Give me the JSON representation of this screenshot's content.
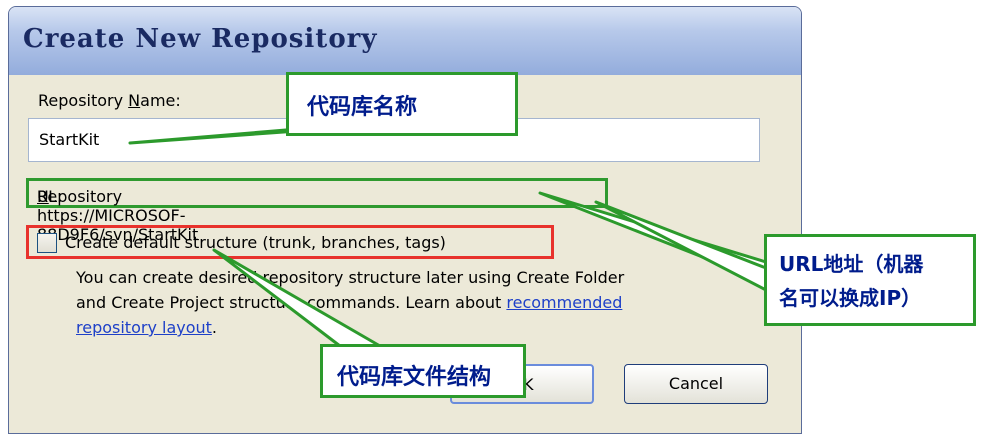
{
  "dialog": {
    "title": "Create New Repository",
    "name_label_pre": "Repository ",
    "name_label_u": "N",
    "name_label_post": "ame:",
    "name_value": "StartKit",
    "url_label_pre": "Repository ",
    "url_label_u": "U",
    "url_label_post": "RL: https://MICROSOF-88D9F6/svn/StartKit",
    "checkbox_label": "Create default structure (trunk, branches, tags)",
    "help_line1": "You can create desired repository structure later using Create Folder",
    "help_line2": "and Create Project structure commands. Learn about ",
    "help_link1": "recommended",
    "help_link2": "repository layout",
    "help_tail": ".",
    "ok_label": "OK",
    "cancel_label": "Cancel"
  },
  "callouts": {
    "name": "代码库名称",
    "url_line1": "URL地址（机器",
    "url_line2": "名可以换成IP）",
    "structure": "代码库文件结构"
  },
  "colors": {
    "callout_border": "#2c9a2c",
    "callout_text": "#001c8c",
    "url_highlight": "#2f9a2f",
    "checkbox_highlight": "#e8322c"
  }
}
